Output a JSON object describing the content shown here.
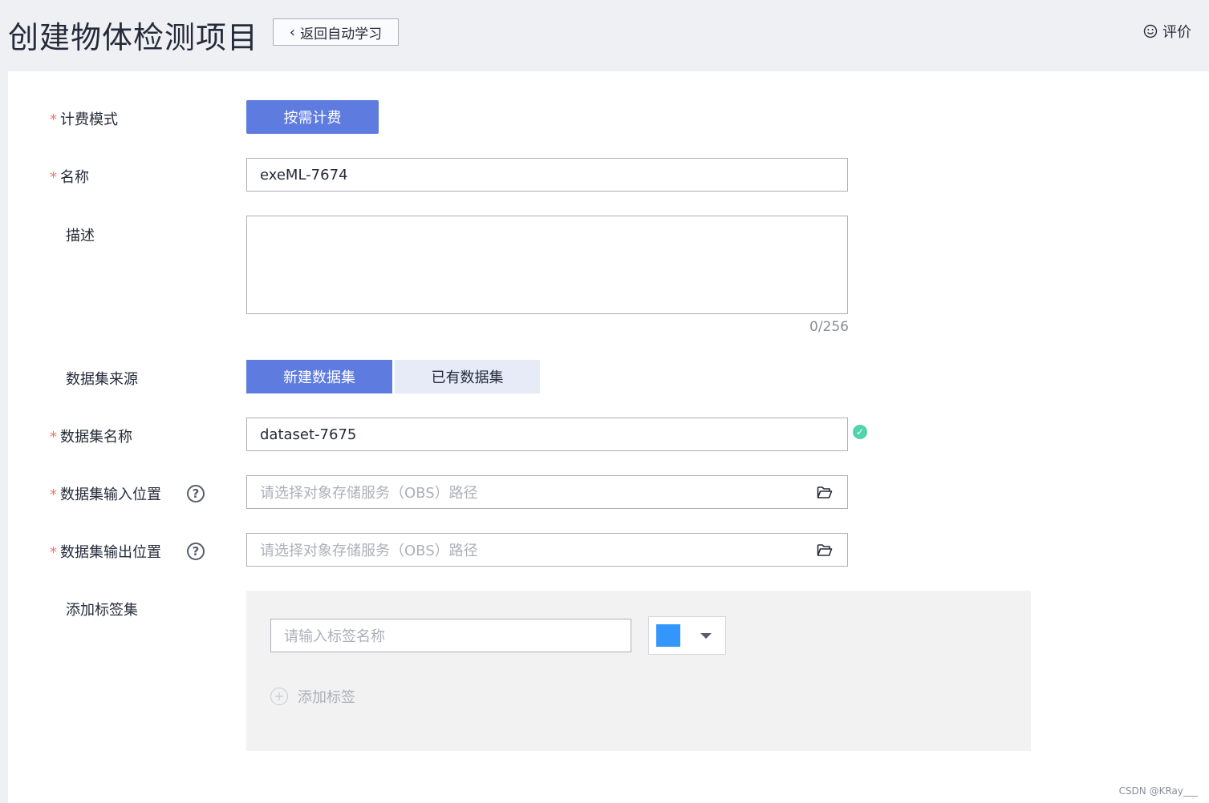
{
  "header": {
    "title": "创建物体检测项目",
    "back_label": "返回自动学习",
    "feedback_label": "评价"
  },
  "form": {
    "billing": {
      "label": "计费模式",
      "required": "*",
      "button": "按需计费"
    },
    "name": {
      "label": "名称",
      "required": "*",
      "value": "exeML-7674"
    },
    "description": {
      "label": "描述",
      "value": "",
      "counter": "0/256"
    },
    "dataset_source": {
      "label": "数据集来源",
      "options": [
        "新建数据集",
        "已有数据集"
      ],
      "selected": "新建数据集"
    },
    "dataset_name": {
      "label": "数据集名称",
      "required": "*",
      "value": "dataset-7675"
    },
    "input_location": {
      "label": "数据集输入位置",
      "required": "*",
      "placeholder": "请选择对象存储服务（OBS）路径"
    },
    "output_location": {
      "label": "数据集输出位置",
      "required": "*",
      "placeholder": "请选择对象存储服务（OBS）路径"
    },
    "tag_set": {
      "label": "添加标签集",
      "tag_placeholder": "请输入标签名称",
      "tag_color": "#3296fa",
      "add_tag_label": "添加标签"
    }
  },
  "icons": {
    "back": "chevron-left-icon",
    "feedback": "smiley-icon",
    "help": "help-circle-icon",
    "folder": "folder-open-icon",
    "valid": "check-circle-icon",
    "add": "plus-circle-icon"
  },
  "colors": {
    "primary": "#5e7ce0",
    "secondary_tab": "#e6ebf7",
    "required": "#f66f6a",
    "success": "#50d4ab"
  },
  "watermark": "CSDN @KRay___"
}
